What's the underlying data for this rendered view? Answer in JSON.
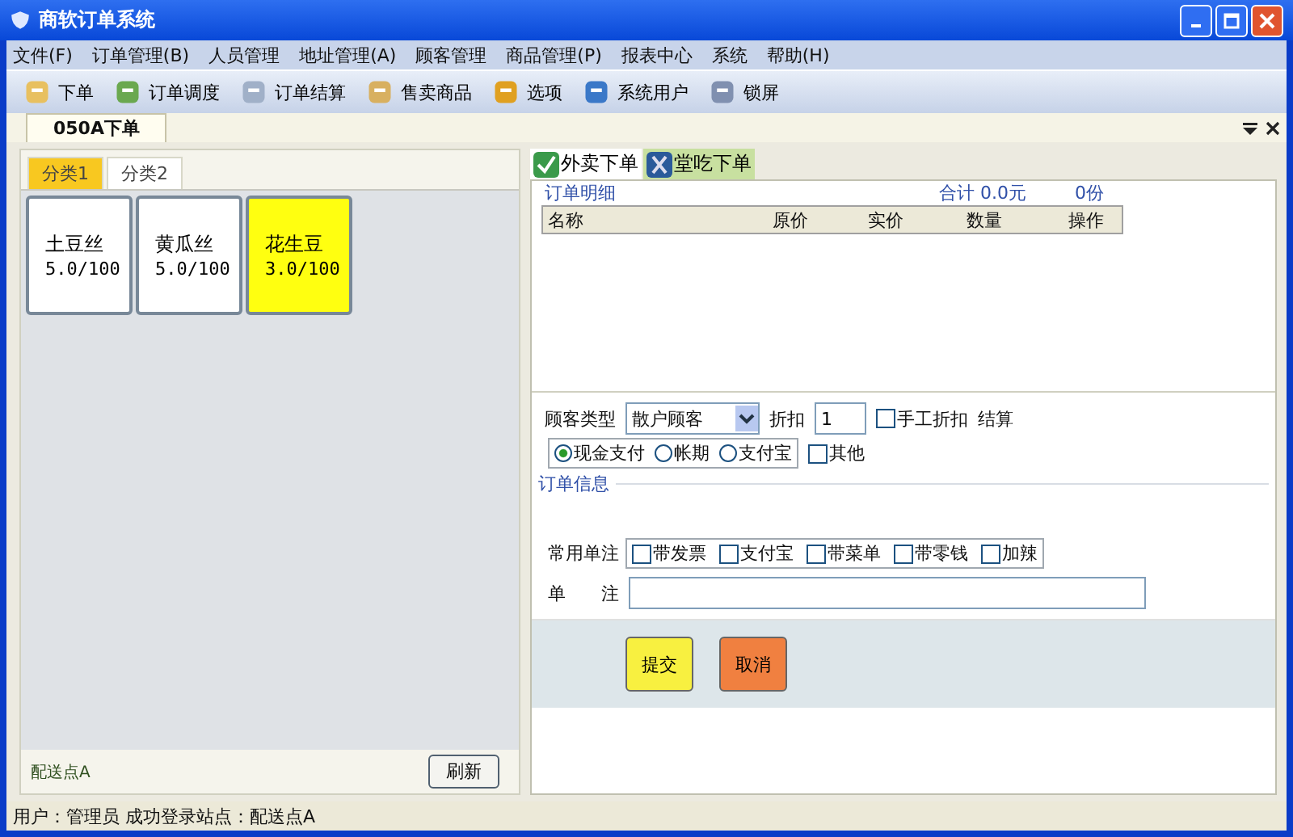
{
  "window": {
    "title": "商软订单系统"
  },
  "menu": [
    "文件(F)",
    "订单管理(B)",
    "人员管理",
    "地址管理(A)",
    "顾客管理",
    "商品管理(P)",
    "报表中心",
    "系统",
    "帮助(H)"
  ],
  "toolbar": [
    "下单",
    "订单调度",
    "订单结算",
    "售卖商品",
    "选项",
    "系统用户",
    "锁屏"
  ],
  "doc_tab": {
    "label": "050A下单"
  },
  "categories": [
    {
      "label": "分类1",
      "selected": true
    },
    {
      "label": "分类2",
      "selected": false
    }
  ],
  "products": [
    {
      "name": "土豆丝",
      "price": "5.0/100",
      "selected": false
    },
    {
      "name": "黄瓜丝",
      "price": "5.0/100",
      "selected": false
    },
    {
      "name": "花生豆",
      "price": "3.0/100",
      "selected": true
    }
  ],
  "station": "配送点A",
  "refresh_button": "刷新",
  "order_tabs": [
    {
      "label": "外卖下单",
      "selected": false
    },
    {
      "label": "堂吃下单",
      "selected": true
    }
  ],
  "order_detail": {
    "title": "订单明细",
    "total": "合计 0.0元",
    "count": "0份",
    "columns": [
      "名称",
      "原价",
      "实价",
      "数量",
      "操作"
    ]
  },
  "customer": {
    "label": "顾客类型",
    "value": "散户顾客",
    "discount_label": "折扣",
    "discount": "1",
    "manual_discount": {
      "label": "手工折扣",
      "checked": false
    },
    "settle_label": "结算"
  },
  "payment": [
    {
      "label": "现金支付",
      "selected": true
    },
    {
      "label": "帐期",
      "selected": false
    },
    {
      "label": "支付宝",
      "selected": false
    }
  ],
  "other": {
    "label": "其他",
    "checked": false
  },
  "order_info": {
    "title": "订单信息",
    "notes_label": "常用单注",
    "notes": [
      {
        "label": "带发票",
        "checked": false
      },
      {
        "label": "支付宝",
        "checked": false
      },
      {
        "label": "带菜单",
        "checked": false
      },
      {
        "label": "带零钱",
        "checked": false
      },
      {
        "label": "加辣",
        "checked": false
      }
    ],
    "remark_label": "单　　注"
  },
  "buttons": [
    {
      "label": "提交",
      "kind": "submit"
    },
    {
      "label": "取消",
      "kind": "cancel"
    }
  ],
  "status_bar": "用户：管理员 成功登录站点：配送点A"
}
